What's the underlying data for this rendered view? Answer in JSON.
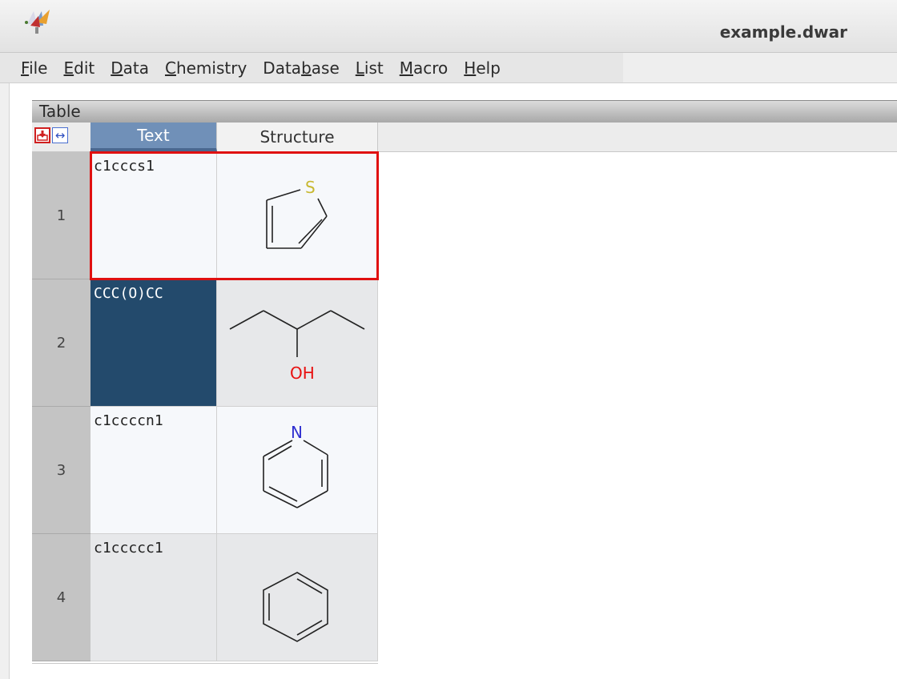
{
  "window": {
    "title": "example.dwar"
  },
  "menu": [
    {
      "pre": "",
      "key": "F",
      "post": "ile"
    },
    {
      "pre": "",
      "key": "E",
      "post": "dit"
    },
    {
      "pre": "",
      "key": "D",
      "post": "ata"
    },
    {
      "pre": "",
      "key": "C",
      "post": "hemistry"
    },
    {
      "pre": "Data",
      "key": "b",
      "post": "ase"
    },
    {
      "pre": "",
      "key": "L",
      "post": "ist"
    },
    {
      "pre": "",
      "key": "M",
      "post": "acro"
    },
    {
      "pre": "",
      "key": "H",
      "post": "elp"
    }
  ],
  "panel": {
    "title": "Table"
  },
  "table": {
    "columns": [
      "Text",
      "Structure"
    ],
    "rows": [
      {
        "num": "1",
        "text": "c1cccs1",
        "atom_label": "S"
      },
      {
        "num": "2",
        "text": "CCC(O)CC",
        "atom_label": "OH"
      },
      {
        "num": "3",
        "text": "c1ccccn1",
        "atom_label": "N"
      },
      {
        "num": "4",
        "text": "c1ccccc1",
        "atom_label": ""
      }
    ]
  },
  "colors": {
    "selected_cell": "#234a6c",
    "focus_outline": "#e01010",
    "sulfur": "#c8b830",
    "oxygen": "#e81010",
    "nitrogen": "#3030d0"
  }
}
